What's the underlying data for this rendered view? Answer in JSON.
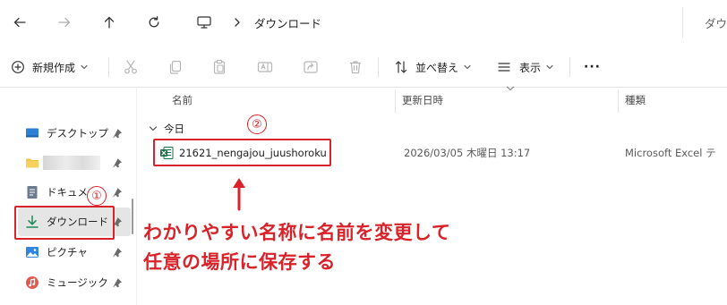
{
  "nav": {
    "back_icon": "arrow-left-icon",
    "forward_icon": "arrow-right-icon",
    "up_icon": "arrow-up-icon",
    "refresh_icon": "refresh-icon",
    "pc_icon": "monitor-icon",
    "breadcrumb": "ダウンロード",
    "search_placeholder": "ダウ"
  },
  "toolbar": {
    "new_label": "新規作成",
    "sort_label": "並べ替え",
    "view_label": "表示",
    "more_label": "···"
  },
  "columns": {
    "name": "名前",
    "date": "更新日時",
    "type": "種類"
  },
  "group": {
    "label": "今日"
  },
  "file": {
    "name": "21621_nengajou_juushoroku",
    "date": "2026/03/05 木曜日 13:17",
    "type": "Microsoft Excel テ"
  },
  "sidebar": {
    "items": [
      {
        "label": "デスクトップ",
        "icon": "desktop-icon"
      },
      {
        "label": "",
        "icon": "folder-icon"
      },
      {
        "label": "ドキュメ",
        "icon": "document-icon"
      },
      {
        "label": "ダウンロード",
        "icon": "download-icon"
      },
      {
        "label": "ピクチャ",
        "icon": "picture-icon"
      },
      {
        "label": "ミュージック",
        "icon": "music-icon"
      }
    ]
  },
  "annotations": {
    "marker_1": "①",
    "marker_2": "②",
    "line_1": "わかりやすい名称に名前を変更して",
    "line_2": "任意の場所に保存する"
  },
  "colors": {
    "annotation": "#d9222a",
    "excel_green": "#1d7044",
    "accent_blue": "#1a6fc7"
  }
}
